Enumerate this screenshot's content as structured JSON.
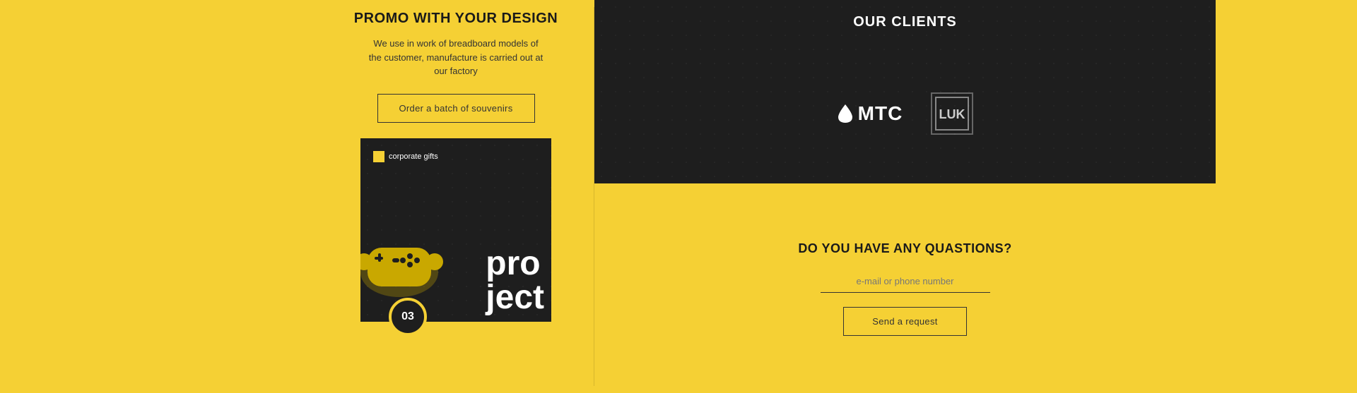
{
  "left": {},
  "middle": {
    "promo_title": "PROMO WITH YOUR DESIGN",
    "promo_desc": "We use in work of breadboard models of the customer, manufacture is carried out at our factory",
    "order_btn": "Order a batch of souvenirs",
    "card_label": "corporate gifts",
    "project_text1": "pro",
    "project_text2": "ject",
    "card_number": "03"
  },
  "clients": {
    "title": "OUR CLIENTS",
    "mtc_name": "MTC",
    "lukoil_label": "LUK"
  },
  "questions": {
    "title": "DO YOU HAVE ANY QUASTIONS?",
    "input_placeholder": "e-mail or phone number",
    "send_btn": "Send a request"
  }
}
